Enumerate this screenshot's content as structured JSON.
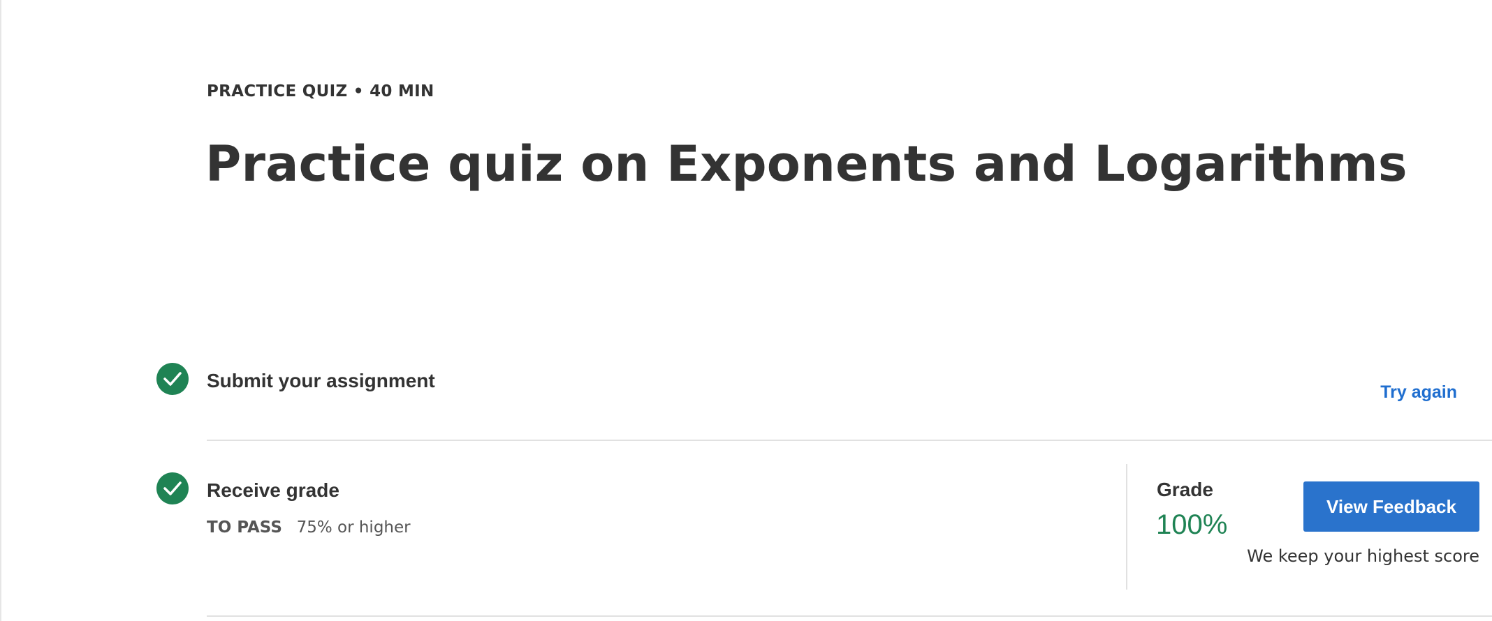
{
  "header": {
    "eyebrow": "PRACTICE QUIZ • 40 MIN",
    "title": "Practice quiz on Exponents and Logarithms"
  },
  "steps": [
    {
      "icon": "check-circle-icon",
      "title": "Submit your assignment",
      "action_label": "Try again"
    },
    {
      "icon": "check-circle-icon",
      "title": "Receive grade",
      "pass_label": "TO PASS",
      "pass_value": "75% or higher",
      "grade_label": "Grade",
      "grade_value": "100%",
      "button_label": "View Feedback",
      "button_note": "We keep your highest score"
    }
  ],
  "colors": {
    "success": "#1f8354",
    "link": "#1f6ecf",
    "primary_button": "#2a73cc",
    "text": "#333333"
  }
}
